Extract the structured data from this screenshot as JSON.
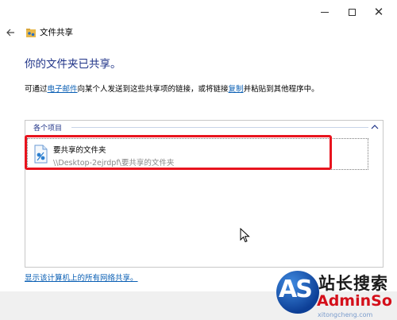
{
  "window": {
    "controls": {
      "minimize_icon": "minimize-icon",
      "maximize_icon": "maximize-icon",
      "close_icon": "close-icon"
    }
  },
  "nav": {
    "back_icon": "back-arrow-icon",
    "title": "文件共享"
  },
  "main": {
    "heading": "你的文件夹已共享。",
    "desc_prefix": "可通过",
    "email_link": "电子邮件",
    "desc_middle": "向某个人发送到这些共享项的链接，或将链接",
    "copy_link": "复制",
    "desc_suffix": "并粘贴到其他程序中。"
  },
  "items_group": {
    "label": "各个项目",
    "items": [
      {
        "name": "要共享的文件夹",
        "path": "\\\\Desktop-2ejrdpf\\要共享的文件夹"
      }
    ]
  },
  "network_link": "显示该计算机上的所有网络共享。",
  "watermark": {
    "badge": "AS",
    "cn_text": "站长搜索",
    "brand": "AdminSo",
    "url": "xitongcheng.com"
  },
  "colors": {
    "heading": "#1e3287",
    "link": "#0a5fb4",
    "highlight": "#e8141e",
    "footer": "#f0f0f0"
  }
}
